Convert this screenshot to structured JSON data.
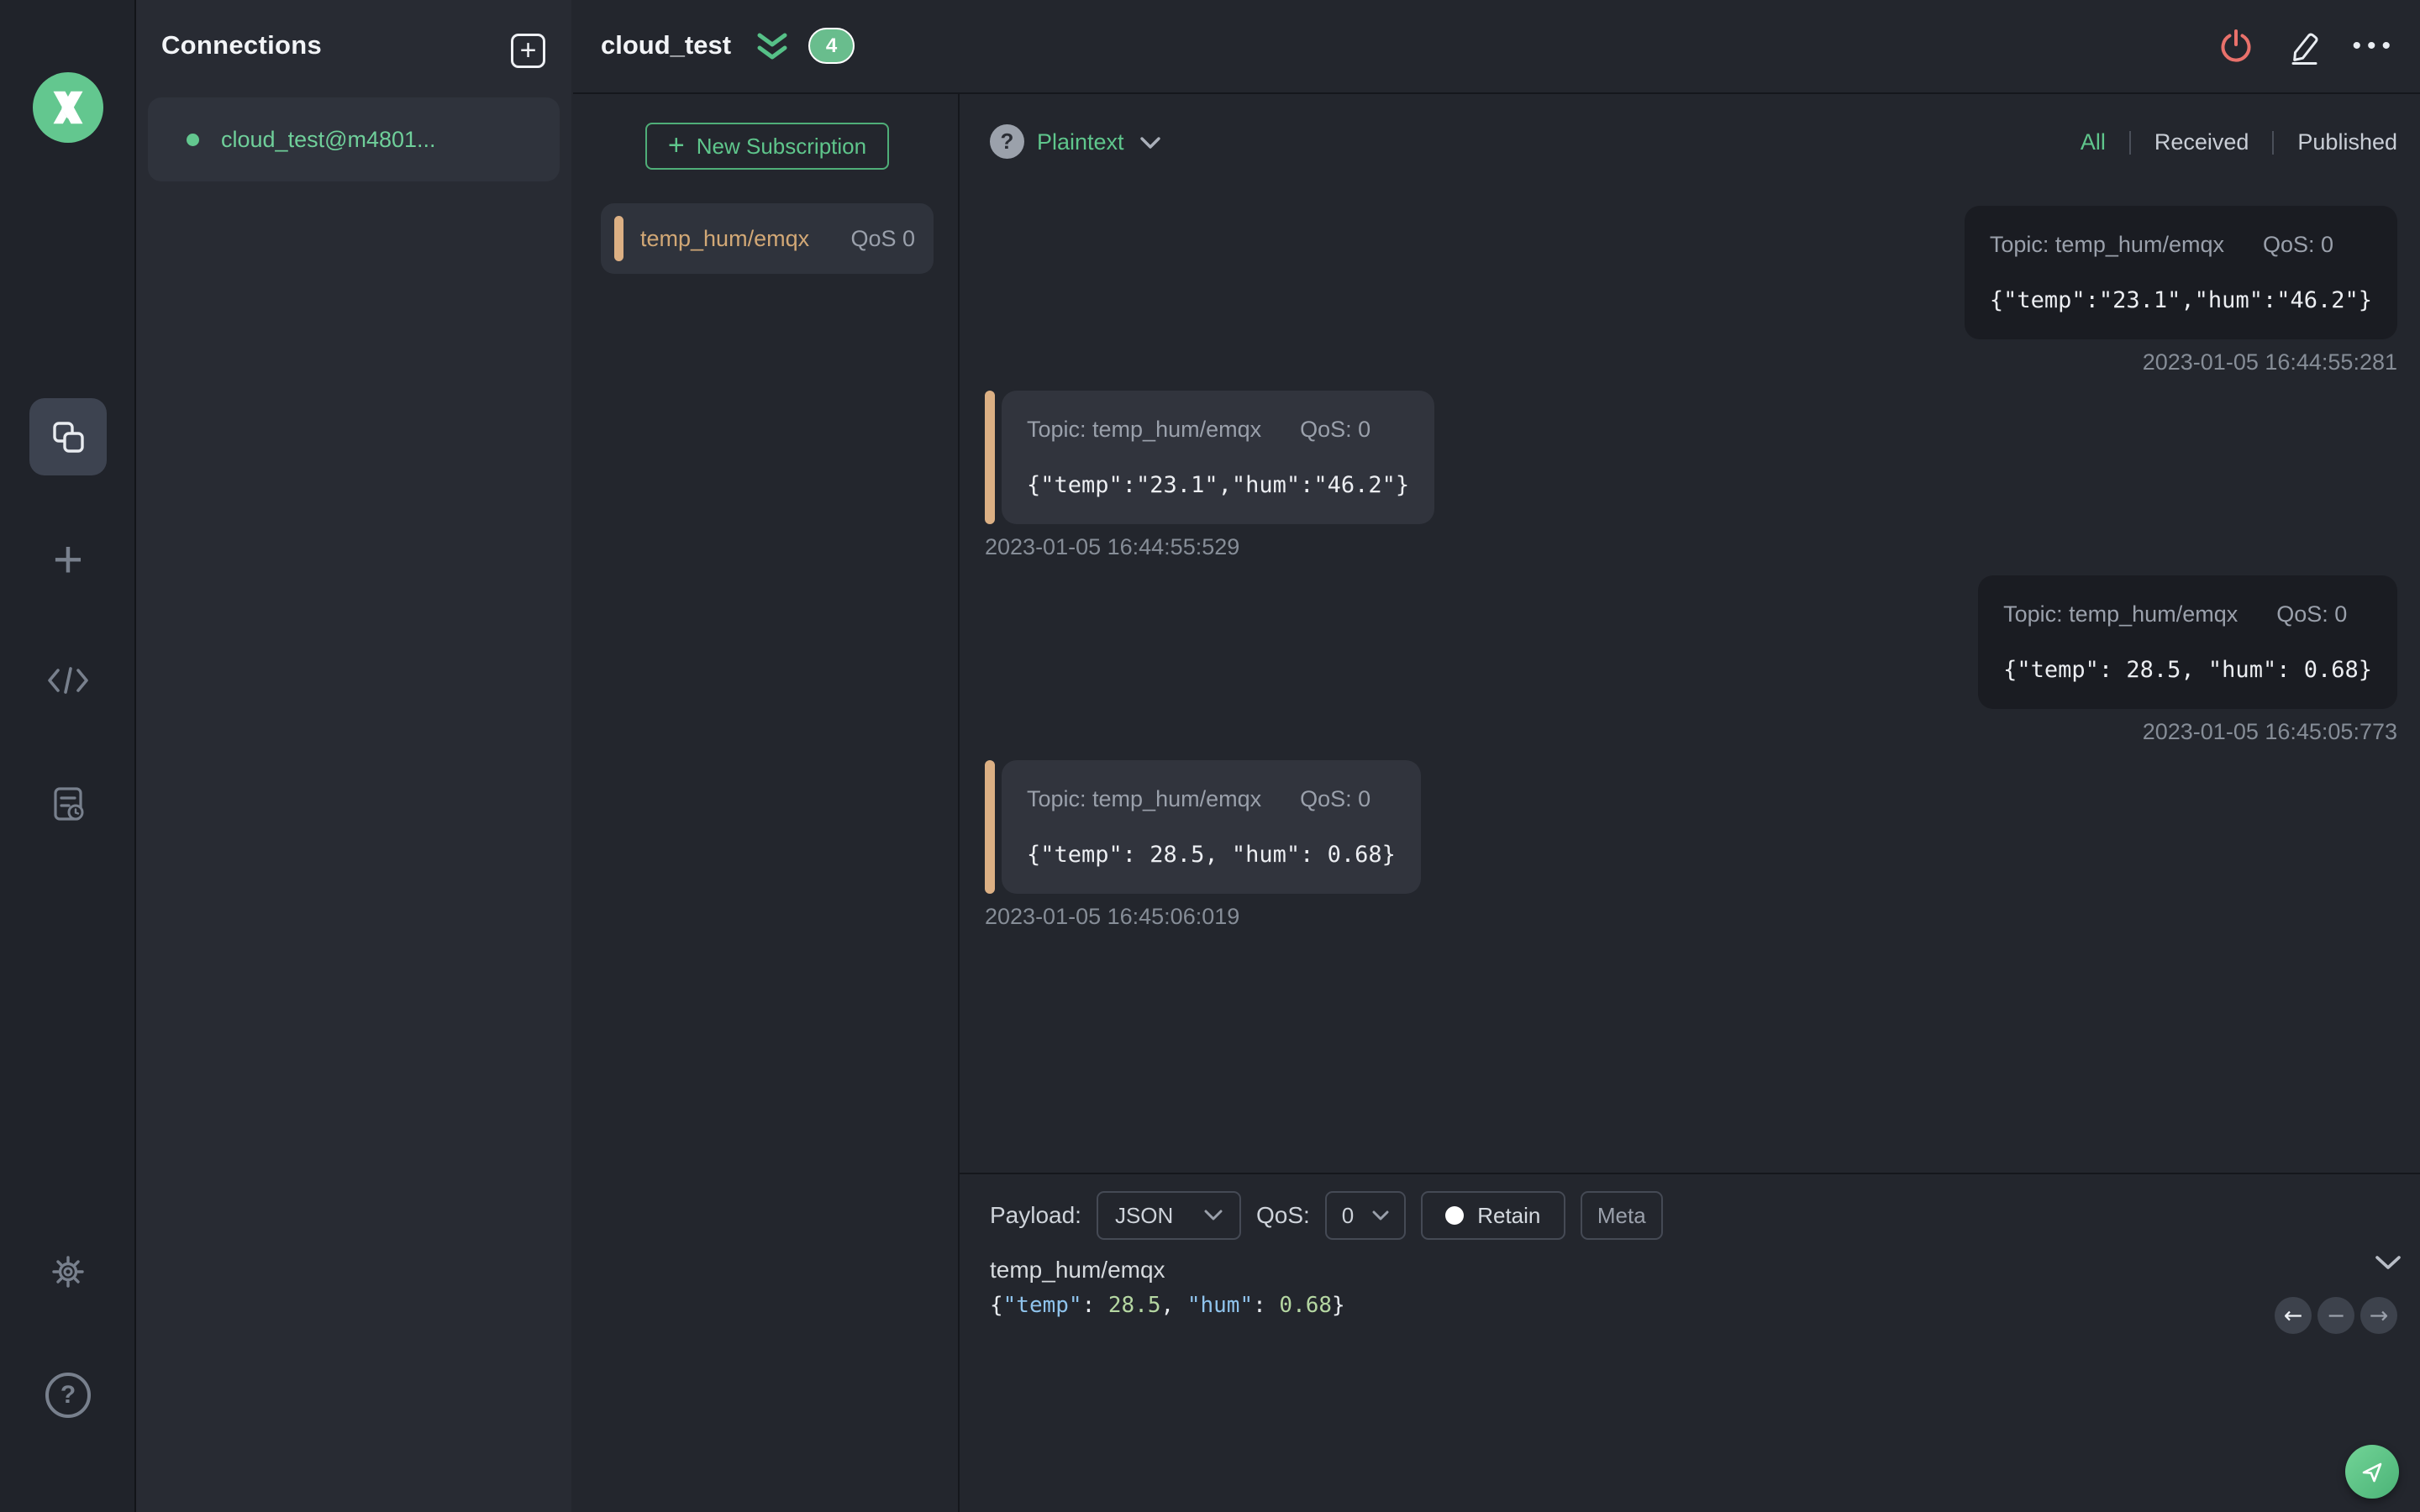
{
  "colors": {
    "accent_green": "#5fc68c",
    "badge_green": "#69bd8d",
    "subscription_tan": "#d2a876",
    "power_coral": "#e9716b",
    "code_key_blue": "#8fc3ec",
    "code_number_green": "#b5d7a2"
  },
  "icons": {
    "plus": "+",
    "ellipsis": "•••",
    "help": "?",
    "arrow_prev": "←",
    "minus": "−",
    "arrow_next": "→"
  },
  "connections": {
    "title": "Connections",
    "items": [
      {
        "name": "cloud_test@m4801..."
      }
    ]
  },
  "header": {
    "connection_name": "cloud_test",
    "badge_count": "4"
  },
  "subscriptions": {
    "new_button_label": "New Subscription",
    "items": [
      {
        "topic": "temp_hum/emqx",
        "qos": "QoS 0"
      }
    ]
  },
  "messages": {
    "format_label": "Plaintext",
    "filters": {
      "all": "All",
      "received": "Received",
      "published": "Published"
    },
    "items": [
      {
        "direction": "published",
        "topic": "Topic: temp_hum/emqx",
        "qos": "QoS: 0",
        "payload": "{\"temp\":\"23.1\",\"hum\":\"46.2\"}",
        "timestamp": "2023-01-05 16:44:55:281"
      },
      {
        "direction": "received",
        "topic": "Topic: temp_hum/emqx",
        "qos": "QoS: 0",
        "payload": "{\"temp\":\"23.1\",\"hum\":\"46.2\"}",
        "timestamp": "2023-01-05 16:44:55:529"
      },
      {
        "direction": "published",
        "topic": "Topic: temp_hum/emqx",
        "qos": "QoS: 0",
        "payload": "{\"temp\": 28.5, \"hum\": 0.68}",
        "timestamp": "2023-01-05 16:45:05:773"
      },
      {
        "direction": "received",
        "topic": "Topic: temp_hum/emqx",
        "qos": "QoS: 0",
        "payload": "{\"temp\": 28.5, \"hum\": 0.68}",
        "timestamp": "2023-01-05 16:45:06:019"
      }
    ]
  },
  "composer": {
    "payload_label": "Payload:",
    "payload_format": "JSON",
    "qos_label": "QoS:",
    "qos_value": "0",
    "retain_label": "Retain",
    "meta_label": "Meta",
    "topic_value": "temp_hum/emqx",
    "code": {
      "open": "{",
      "key1": "\"temp\"",
      "colon1": ": ",
      "num1": "28.5",
      "comma": ", ",
      "key2": "\"hum\"",
      "colon2": ": ",
      "num2": "0.68",
      "close": "}"
    }
  }
}
